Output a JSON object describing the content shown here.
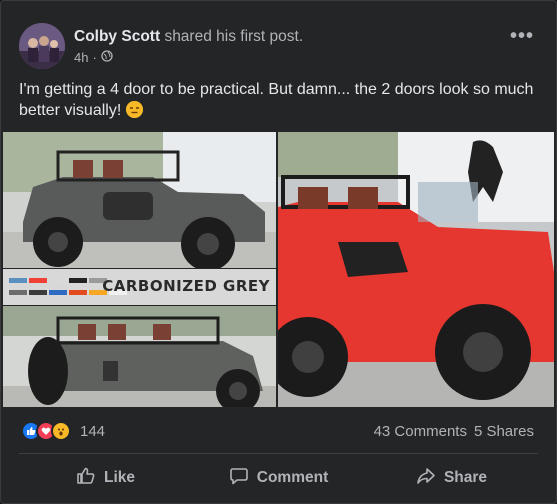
{
  "post": {
    "author": "Colby Scott",
    "action": "shared his first post.",
    "time": "4h",
    "text": "I'm getting a 4 door to be practical. But damn... the 2 doors look so much better visually!"
  },
  "photos": {
    "overlay_caption": "CARBONIZED GREY"
  },
  "engagement": {
    "reaction_count": "144",
    "comments": "43 Comments",
    "shares": "5 Shares"
  },
  "actions": {
    "like": "Like",
    "comment": "Comment",
    "share": "Share"
  },
  "icons": {
    "globe": "globe-icon",
    "more": "more-icon",
    "like": "thumbs-up-icon",
    "comment": "comment-icon",
    "share": "share-icon"
  },
  "colors": {
    "background": "#242526",
    "text_primary": "#e4e6eb",
    "text_secondary": "#b0b3b8",
    "like_blue": "#1877f2",
    "love_red": "#f33e58",
    "wow_yellow": "#f7b928",
    "jeep_red": "#e5362f"
  }
}
